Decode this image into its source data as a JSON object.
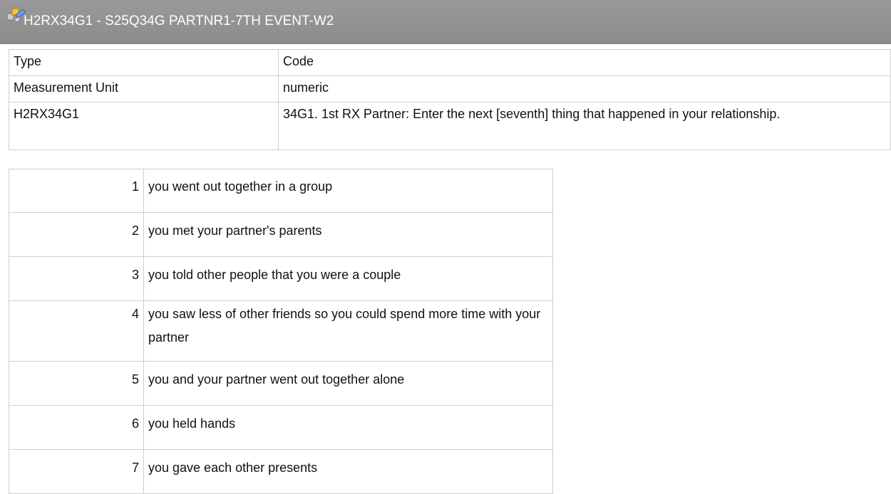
{
  "header": {
    "title": "H2RX34G1 - S25Q34G PARTNR1-7TH EVENT-W2",
    "icon": "variable-icon"
  },
  "meta": [
    {
      "key": "Type",
      "value": "Code"
    },
    {
      "key": "Measurement Unit",
      "value": "numeric"
    },
    {
      "key": "H2RX34G1",
      "value": "34G1. 1st RX Partner: Enter the next [seventh] thing that happened in your relationship."
    }
  ],
  "codes": [
    {
      "code": "1",
      "label": "you went out together in a group"
    },
    {
      "code": "2",
      "label": "you met your partner's parents"
    },
    {
      "code": "3",
      "label": "you told other people that you were a couple"
    },
    {
      "code": "4",
      "label": "you saw less of other friends so you could spend more time with your partner"
    },
    {
      "code": "5",
      "label": "you and your partner went out together alone"
    },
    {
      "code": "6",
      "label": "you held hands"
    },
    {
      "code": "7",
      "label": "you gave each other presents"
    }
  ]
}
